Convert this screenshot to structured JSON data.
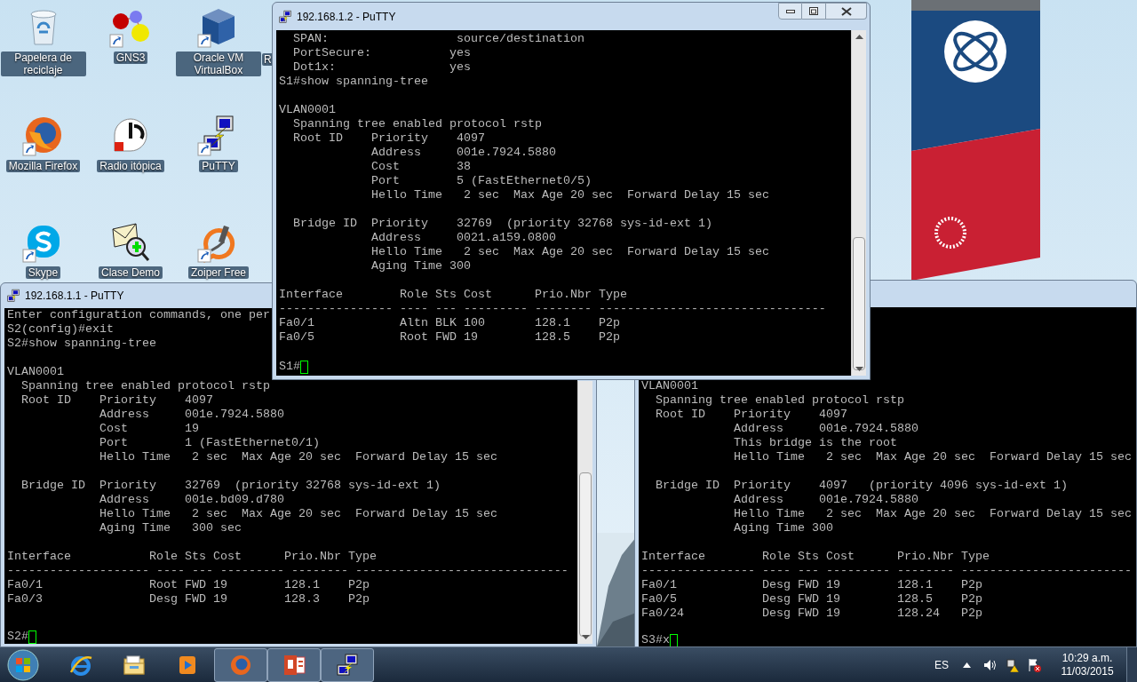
{
  "desktop": {
    "icons": [
      {
        "label": "Papelera de reciclaje",
        "kind": "recycle_bin",
        "shortcut": false
      },
      {
        "label": "GNS3",
        "kind": "gns3",
        "shortcut": true
      },
      {
        "label": "Oracle VM VirtualBox",
        "kind": "virtualbox",
        "shortcut": true
      },
      {
        "label": "Mozilla Firefox",
        "kind": "firefox",
        "shortcut": true
      },
      {
        "label": "Radio itópica",
        "kind": "radio",
        "shortcut": false
      },
      {
        "label": "PuTTY",
        "kind": "putty",
        "shortcut": true
      },
      {
        "label": "Skype",
        "kind": "skype",
        "shortcut": true
      },
      {
        "label": "Clase Demo",
        "kind": "clase_demo",
        "shortcut": false
      },
      {
        "label": "Zoiper Free",
        "kind": "zoiper",
        "shortcut": true
      }
    ],
    "cut_label": "R"
  },
  "windows": [
    {
      "title": "192.168.1.2 - PuTTY",
      "controls": true,
      "blocks": [
        [
          "  SPAN:                  source/destination",
          "  PortSecure:           yes",
          "  Dot1x:                yes",
          "S1#show spanning-tree"
        ],
        [
          "VLAN0001",
          "  Spanning tree enabled protocol rstp",
          "  Root ID    Priority    4097",
          "             Address     001e.7924.5880",
          "             Cost        38",
          "             Port        5 (FastEthernet0/5)",
          "             Hello Time   2 sec  Max Age 20 sec  Forward Delay 15 sec"
        ],
        [
          "  Bridge ID  Priority    32769  (priority 32768 sys-id-ext 1)",
          "             Address     0021.a159.0800",
          "             Hello Time   2 sec  Max Age 20 sec  Forward Delay 15 sec",
          "             Aging Time 300"
        ],
        [
          "Interface        Role Sts Cost      Prio.Nbr Type",
          "---------------- ---- --- --------- -------- --------------------------------",
          "Fa0/1            Altn BLK 100       128.1    P2p",
          "Fa0/5            Root FWD 19        128.5    P2p"
        ]
      ],
      "prompt": "S1#"
    },
    {
      "title": "192.168.1.1 - PuTTY",
      "blocks": [
        [
          "Enter configuration commands, one per",
          "S2(config)#exit",
          "S2#show spanning-tree"
        ],
        [
          "VLAN0001",
          "  Spanning tree enabled protocol rstp",
          "  Root ID    Priority    4097",
          "             Address     001e.7924.5880",
          "             Cost        19",
          "             Port        1 (FastEthernet0/1)",
          "             Hello Time   2 sec  Max Age 20 sec  Forward Delay 15 sec"
        ],
        [
          "  Bridge ID  Priority    32769  (priority 32768 sys-id-ext 1)",
          "             Address     001e.bd09.d780",
          "             Hello Time   2 sec  Max Age 20 sec  Forward Delay 15 sec",
          "             Aging Time   300 sec"
        ],
        [
          "Interface           Role Sts Cost      Prio.Nbr Type",
          "-------------------- ---- --- --------- -------- ------------------------------",
          "Fa0/1               Root FWD 19        128.1    P2p",
          "Fa0/3               Desg FWD 19        128.3    P2p"
        ]
      ],
      "prompt": "S2#"
    },
    {
      "blocks": [
        [
          "VLAN0001",
          "  Spanning tree enabled protocol rstp",
          "  Root ID    Priority    4097",
          "             Address     001e.7924.5880",
          "             This bridge is the root",
          "             Hello Time   2 sec  Max Age 20 sec  Forward Delay 15 sec"
        ],
        [
          "  Bridge ID  Priority    4097   (priority 4096 sys-id-ext 1)",
          "             Address     001e.7924.5880",
          "             Hello Time   2 sec  Max Age 20 sec  Forward Delay 15 sec",
          "             Aging Time 300"
        ],
        [
          "Interface        Role Sts Cost      Prio.Nbr Type",
          "---------------- ---- --- --------- -------- ------------------------",
          "Fa0/1            Desg FWD 19        128.1    P2p",
          "Fa0/5            Desg FWD 19        128.5    P2p",
          "Fa0/24           Desg FWD 19        128.24   P2p"
        ]
      ],
      "prompt": "S3#x"
    }
  ],
  "taskbar": {
    "apps": [
      {
        "kind": "ie",
        "running": false
      },
      {
        "kind": "explorer",
        "running": false
      },
      {
        "kind": "media",
        "running": false
      },
      {
        "kind": "firefox",
        "running": true
      },
      {
        "kind": "powerpoint",
        "running": true
      },
      {
        "kind": "putty",
        "running": true
      }
    ],
    "tray": {
      "language": "ES",
      "time": "10:29 a.m.",
      "date": "11/03/2015"
    }
  }
}
